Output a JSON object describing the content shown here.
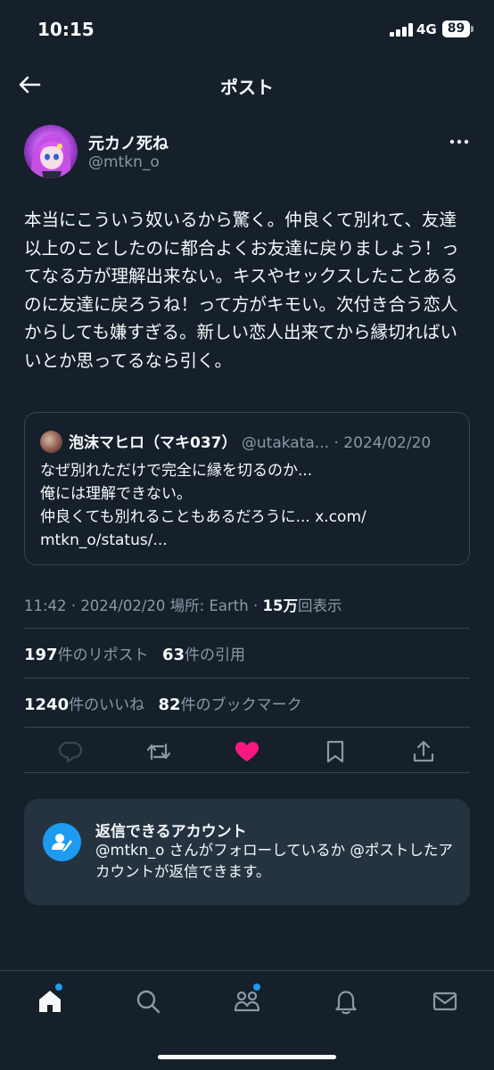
{
  "status_bar": {
    "time": "10:15",
    "network": "4G",
    "battery": "89"
  },
  "header": {
    "title": "ポスト"
  },
  "author": {
    "name": "元カノ死ね",
    "handle": "@mtkn_o"
  },
  "post": {
    "text": "本当にこういう奴いるから驚く。仲良くて別れて、友達以上のことしたのに都合よくお友達に戻りましょう！ってなる方が理解出来ない。キスやセックスしたことあるのに友達に戻ろうね！って方がキモい。次付き合う恋人からしても嫌すぎる。新しい恋人出来てから縁切ればいいとか思ってるなら引く。"
  },
  "quote": {
    "name": "泡沫マヒロ（マキ037）",
    "handle": "@utakata...",
    "date": "2024/02/20",
    "lines": [
      "なぜ別れただけで完全に縁を切るのか...",
      "俺には理解できない。",
      "仲良くても別れることもあるだろうに... x.com/",
      "mtkn_o/status/..."
    ]
  },
  "meta": {
    "time": "11:42",
    "date": "2024/02/20",
    "location": "場所: Earth",
    "views_count": "15万",
    "views_label": "回表示"
  },
  "stats": {
    "reposts_count": "197",
    "reposts_label": "件のリポスト",
    "quotes_count": "63",
    "quotes_label": "件の引用",
    "likes_count": "1240",
    "likes_label": "件のいいね",
    "bookmarks_count": "82",
    "bookmarks_label": "件のブックマーク"
  },
  "reply_info": {
    "title": "返信できるアカウント",
    "description": "@mtkn_o さんがフォローしているか @ポストしたアカウントが返信できます。"
  },
  "colors": {
    "background": "#15202b",
    "accent": "#1d9bf0",
    "like": "#f91880",
    "muted": "#8b98a5",
    "card": "#253341"
  },
  "icons": {
    "header": [
      "back-arrow-icon"
    ],
    "actions": [
      "reply-icon",
      "repost-icon",
      "like-icon",
      "bookmark-icon",
      "share-icon"
    ],
    "nav": [
      "home-icon",
      "search-icon",
      "communities-icon",
      "notifications-icon",
      "messages-icon"
    ]
  }
}
